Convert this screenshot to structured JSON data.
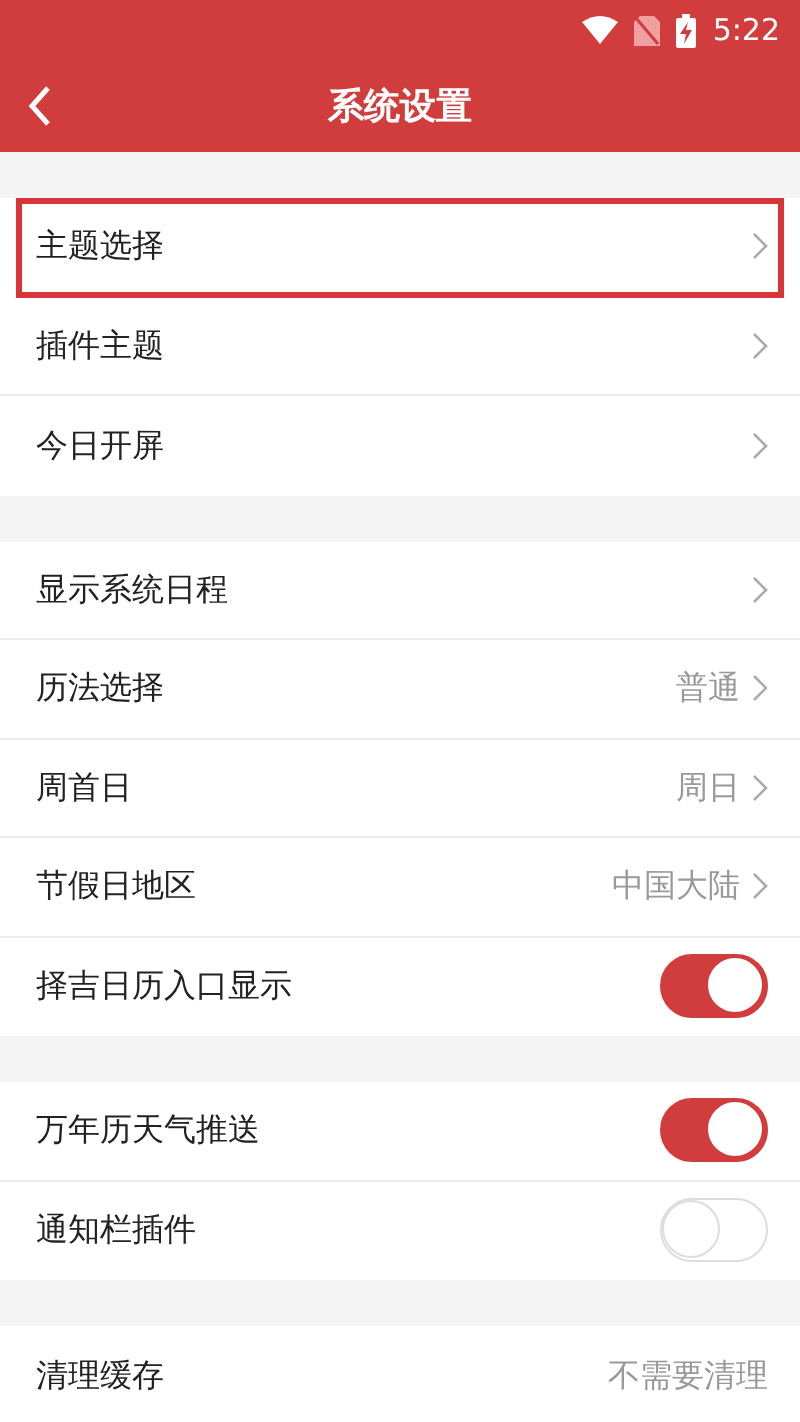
{
  "status_bar": {
    "time": "5:22"
  },
  "header": {
    "title": "系统设置"
  },
  "groups": [
    {
      "items": [
        {
          "kind": "link",
          "label": "主题选择",
          "selected": true
        },
        {
          "kind": "link",
          "label": "插件主题",
          "selected": false
        },
        {
          "kind": "link",
          "label": "今日开屏",
          "selected": false
        }
      ]
    },
    {
      "items": [
        {
          "kind": "link",
          "label": "显示系统日程",
          "selected": false
        },
        {
          "kind": "link",
          "label": "历法选择",
          "value": "普通",
          "selected": false
        },
        {
          "kind": "link",
          "label": "周首日",
          "value": "周日",
          "selected": false
        },
        {
          "kind": "link",
          "label": "节假日地区",
          "value": "中国大陆",
          "selected": false
        },
        {
          "kind": "toggle",
          "label": "择吉日历入口显示",
          "on": true,
          "selected": false
        }
      ]
    },
    {
      "items": [
        {
          "kind": "toggle",
          "label": "万年历天气推送",
          "on": true,
          "selected": false
        },
        {
          "kind": "toggle",
          "label": "通知栏插件",
          "on": false,
          "selected": false
        }
      ]
    },
    {
      "items": [
        {
          "kind": "info",
          "label": "清理缓存",
          "value": "不需要清理",
          "selected": false
        }
      ]
    }
  ]
}
